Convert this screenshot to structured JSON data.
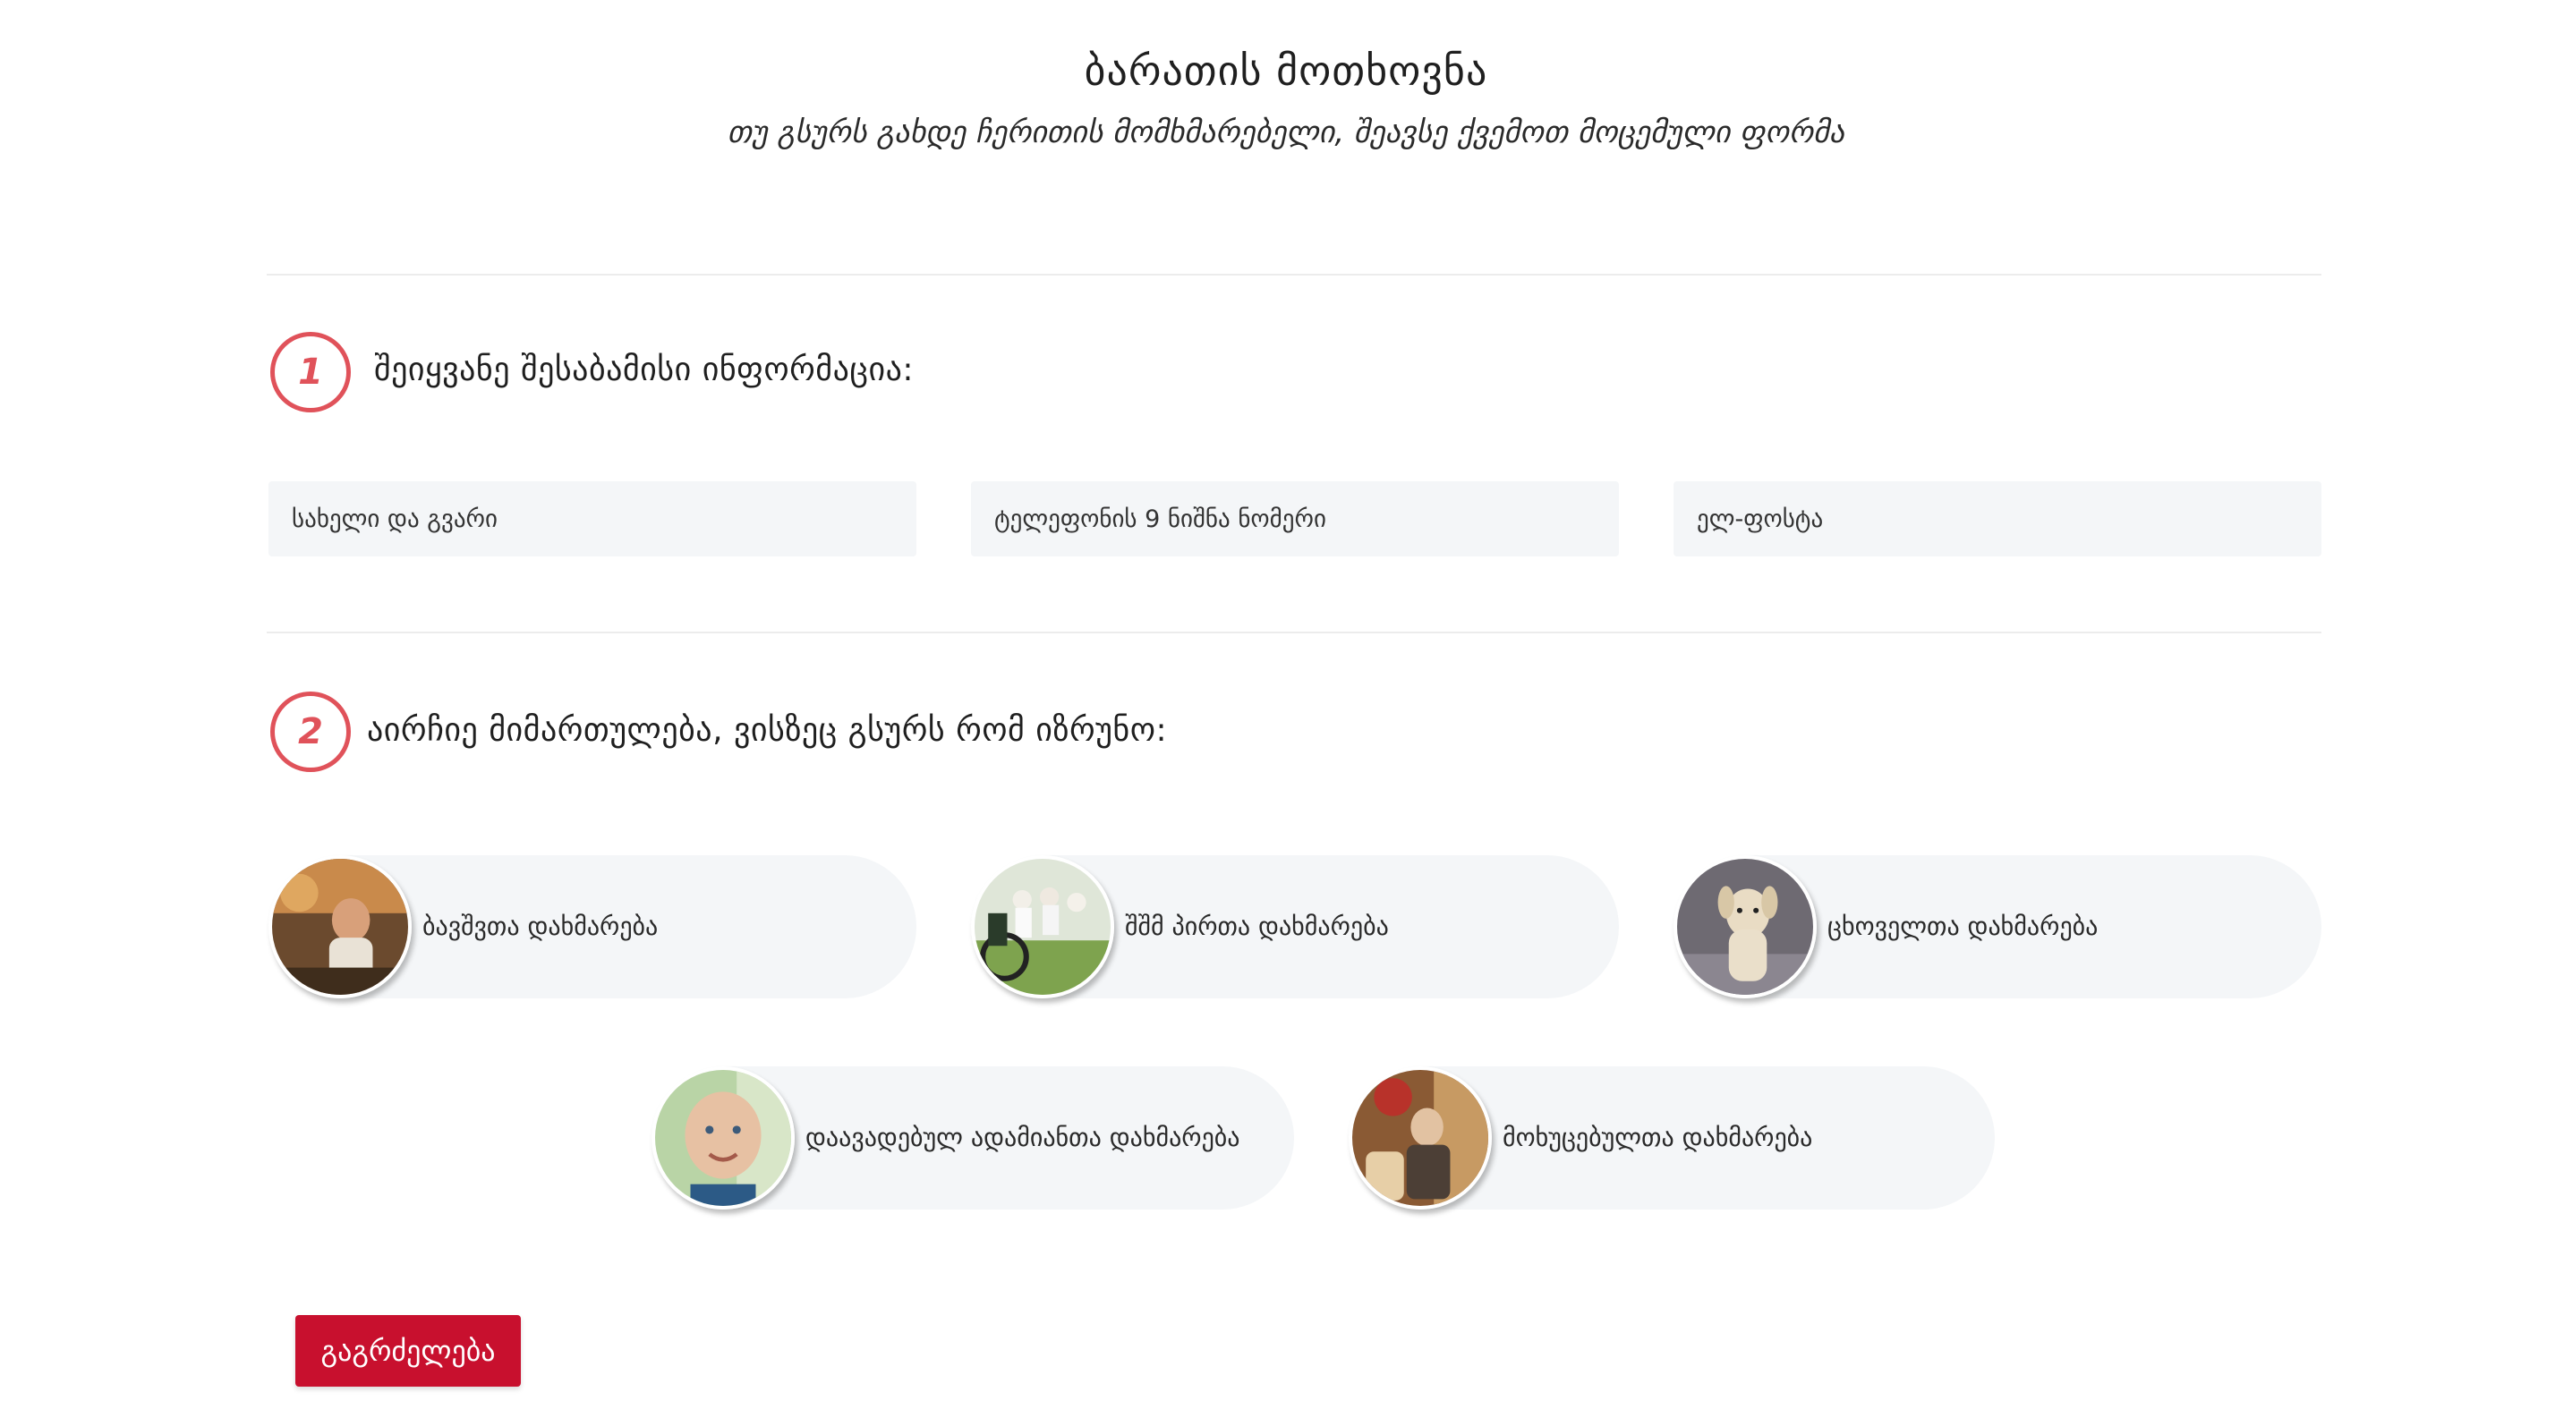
{
  "header": {
    "title": "ბარათის მოთხოვნა",
    "subtitle": "თუ გსურს გახდე ჩერითის მომხმარებელი, შეავსე ქვემოთ მოცემული ფორმა"
  },
  "step1": {
    "number": "1",
    "title": "შეიყვანე შესაბამისი ინფორმაცია:",
    "fields": {
      "name_placeholder": "სახელი და გვარი",
      "phone_placeholder": "ტელეფონის 9 ნიშნა ნომერი",
      "email_placeholder": "ელ-ფოსტა"
    }
  },
  "step2": {
    "number": "2",
    "title": "აირჩიე მიმართულება, ვისზეც გსურს რომ იზრუნო:",
    "options": [
      {
        "label": "ბავშვთა დახმარება",
        "icon": "child-photo-icon"
      },
      {
        "label": "შშმ პირთა დახმარება",
        "icon": "wheelchair-photo-icon"
      },
      {
        "label": "ცხოველთა დახმარება",
        "icon": "dog-photo-icon"
      },
      {
        "label": "დაავადებულ ადამიანთა დახმარება",
        "icon": "sick-child-photo-icon"
      },
      {
        "label": "მოხუცებულთა დახმარება",
        "icon": "elderly-photo-icon"
      }
    ]
  },
  "actions": {
    "continue_label": "გაგრძელება"
  },
  "colors": {
    "accent": "#e0525a",
    "button": "#c8102e",
    "field_bg": "#f4f6f8"
  }
}
